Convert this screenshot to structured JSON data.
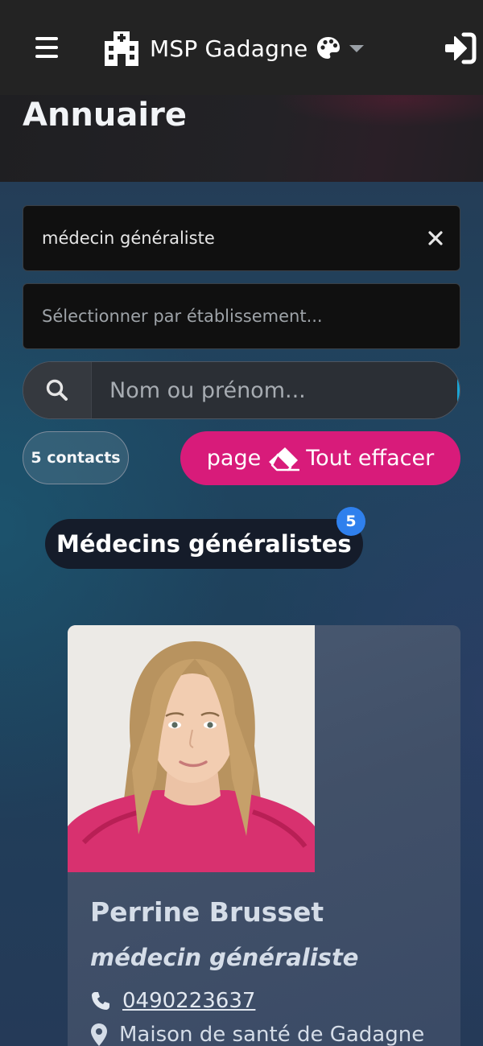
{
  "header": {
    "brand": "MSP Gadagne",
    "icons": {
      "menu": "hamburger-menu-icon",
      "brand": "clinic-building-icon",
      "theme": "palette-icon",
      "theme_caret": "chevron-down-icon",
      "login": "sign-in-icon"
    }
  },
  "page": {
    "title": "Annuaire"
  },
  "filters": {
    "specialty_value": "médecin généraliste",
    "establishment_placeholder": "Sélectionner par établissement...",
    "name_placeholder": "Nom ou prénom..."
  },
  "results": {
    "count_label": "5 contacts",
    "clear_prefix": "page",
    "clear_label": "Tout effacer"
  },
  "group": {
    "title": "Médecins généralistes",
    "count": "5"
  },
  "contacts": [
    {
      "name": "Perrine Brusset",
      "role": "médecin généraliste",
      "phone": "0490223637",
      "location": "Maison de santé de Gadagne"
    }
  ],
  "colors": {
    "navbar": "#232323",
    "accent_pink": "#d81b7a",
    "badge_blue": "#2f80ed",
    "card": "#445470"
  }
}
